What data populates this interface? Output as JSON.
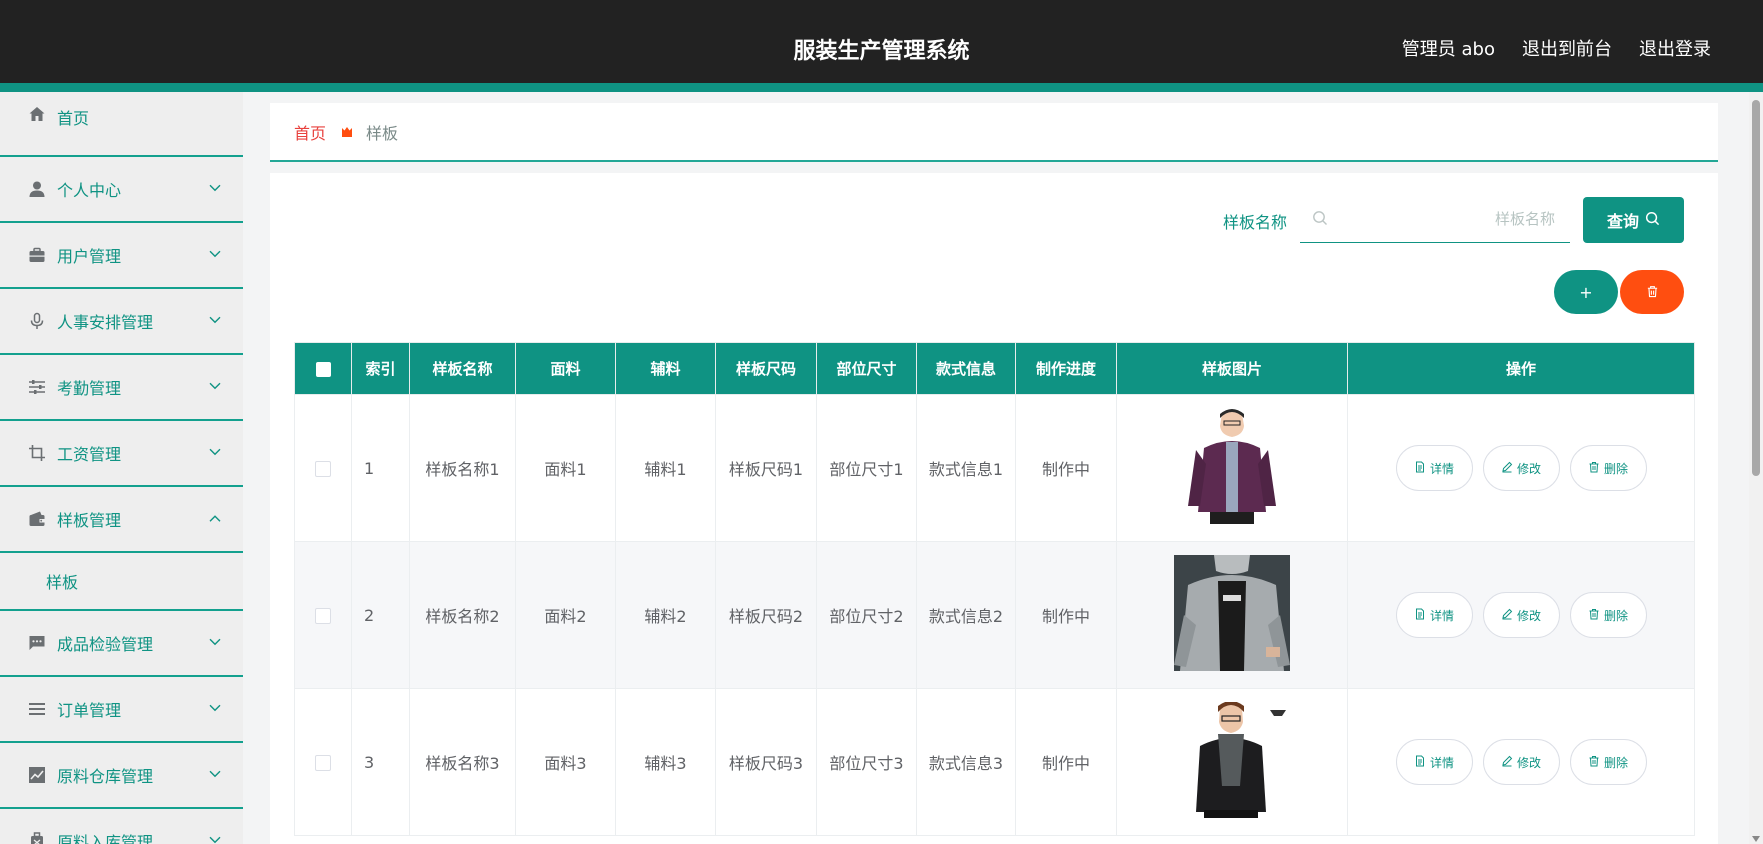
{
  "header": {
    "title": "服装生产管理系统",
    "admin_label": "管理员 abo",
    "front_label": "退出到前台",
    "logout_label": "退出登录"
  },
  "sidebar": {
    "items": [
      {
        "label": "首页",
        "icon": "home-icon"
      },
      {
        "label": "个人中心",
        "icon": "user-icon"
      },
      {
        "label": "用户管理",
        "icon": "briefcase-icon"
      },
      {
        "label": "人事安排管理",
        "icon": "microphone-icon"
      },
      {
        "label": "考勤管理",
        "icon": "sliders-icon"
      },
      {
        "label": "工资管理",
        "icon": "crop-icon"
      },
      {
        "label": "样板管理",
        "icon": "wallet-icon",
        "expanded": true
      },
      {
        "label": "成品检验管理",
        "icon": "message-icon"
      },
      {
        "label": "订单管理",
        "icon": "list-icon"
      },
      {
        "label": "原料仓库管理",
        "icon": "chart-icon"
      },
      {
        "label": "原料入库管理",
        "icon": "suitcase-icon"
      }
    ],
    "submenu_label": "样板"
  },
  "breadcrumb": {
    "home": "首页",
    "current": "样板"
  },
  "search": {
    "label": "样板名称",
    "placeholder": "样板名称",
    "value": "",
    "button_label": "查询"
  },
  "actions": {
    "add_label": "+"
  },
  "table": {
    "headers": [
      "索引",
      "样板名称",
      "面料",
      "辅料",
      "样板尺码",
      "部位尺寸",
      "款式信息",
      "制作进度",
      "样板图片",
      "操作"
    ],
    "rows": [
      {
        "index": "1",
        "name": "样板名称1",
        "fabric": "面料1",
        "accessory": "辅料1",
        "size": "样板尺码1",
        "part_size": "部位尺寸1",
        "style": "款式信息1",
        "progress": "制作中",
        "image": "purple jacket model"
      },
      {
        "index": "2",
        "name": "样板名称2",
        "fabric": "面料2",
        "accessory": "辅料2",
        "size": "样板尺码2",
        "part_size": "部位尺寸2",
        "style": "款式信息2",
        "progress": "制作中",
        "image": "grey hooded jacket"
      },
      {
        "index": "3",
        "name": "样板名称3",
        "fabric": "面料3",
        "accessory": "辅料3",
        "size": "样板尺码3",
        "part_size": "部位尺寸3",
        "style": "款式信息3",
        "progress": "制作中",
        "image": "black jacket model"
      }
    ],
    "op_labels": {
      "detail": "详情",
      "edit": "修改",
      "delete": "删除"
    }
  },
  "colors": {
    "primary": "#0f9383",
    "danger": "#ff4e10",
    "header_bg": "#222222",
    "breadcrumb_home": "#e8413d"
  }
}
